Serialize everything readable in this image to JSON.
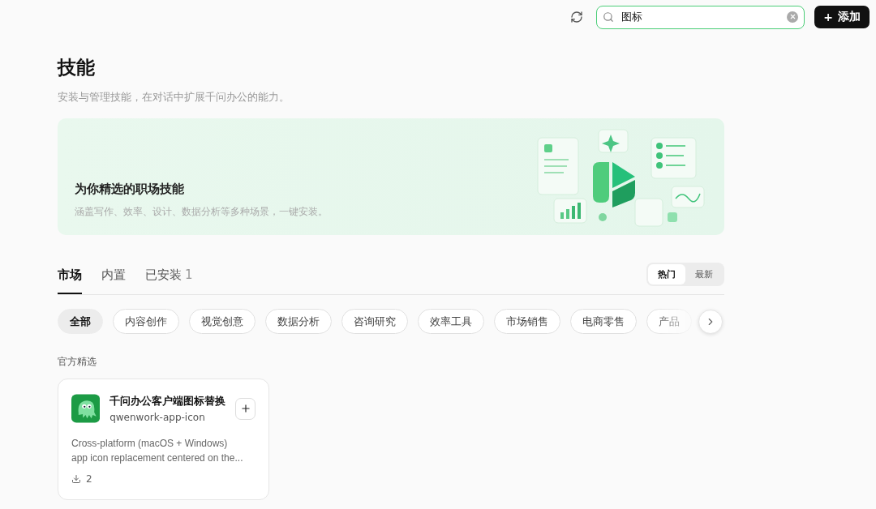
{
  "toolbar": {
    "search": {
      "value": "图标"
    },
    "add_button": {
      "icon": "+",
      "label": "添加"
    }
  },
  "header": {
    "title": "技能",
    "subtitle": "安装与管理技能，在对话中扩展千问办公的能力。"
  },
  "banner": {
    "title": "为你精选的职场技能",
    "subtitle": "涵盖写作、效率、设计、数据分析等多种场景，一键安装。"
  },
  "tabs": [
    {
      "label": "市场",
      "selected": true
    },
    {
      "label": "内置",
      "selected": false
    },
    {
      "label": "已安装",
      "count": "1",
      "selected": false
    }
  ],
  "sort": [
    {
      "label": "热门",
      "selected": true
    },
    {
      "label": "最新",
      "selected": false
    }
  ],
  "categories": [
    {
      "label": "全部",
      "selected": true
    },
    {
      "label": "内容创作",
      "selected": false
    },
    {
      "label": "视觉创意",
      "selected": false
    },
    {
      "label": "数据分析",
      "selected": false
    },
    {
      "label": "咨询研究",
      "selected": false
    },
    {
      "label": "效率工具",
      "selected": false
    },
    {
      "label": "市场销售",
      "selected": false
    },
    {
      "label": "电商零售",
      "selected": false
    },
    {
      "label": "产品",
      "selected": false
    }
  ],
  "section": {
    "title": "官方精选",
    "cards": [
      {
        "name": "千问办公客户端图标替换",
        "slug": "qwenwork-app-icon",
        "description": "Cross-platform (macOS + Windows) app icon replacement centered on the...",
        "downloads": "2"
      }
    ]
  }
}
